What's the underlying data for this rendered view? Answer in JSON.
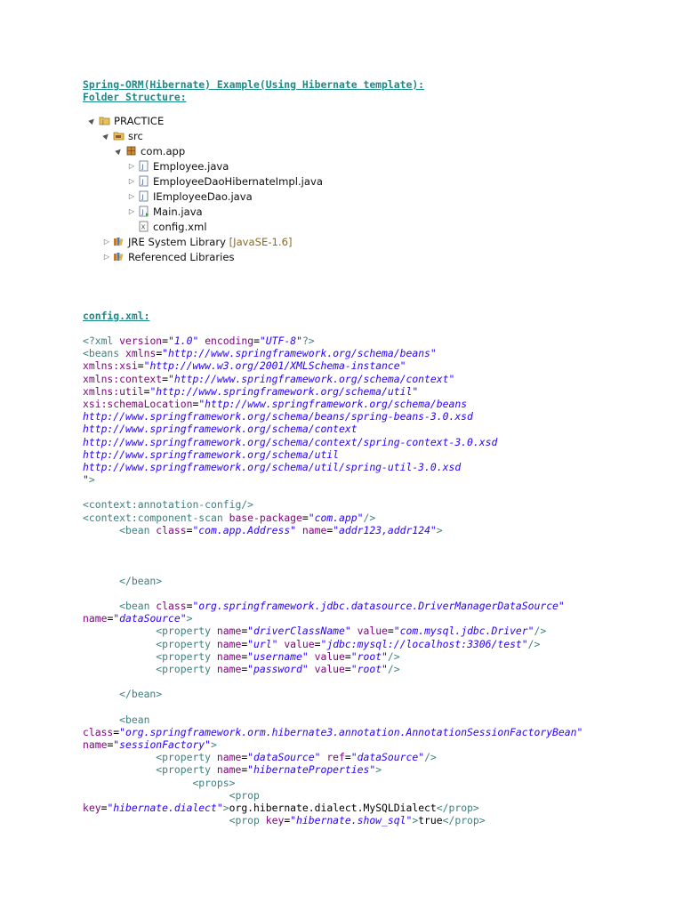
{
  "headings": {
    "title": "Spring-ORM(Hibernate) Example(Using Hibernate template):",
    "folder": "Folder Structure:",
    "config": "config.xml:"
  },
  "tree": [
    {
      "expander": "▲",
      "icon": "project-icon",
      "label": "PRACTICE"
    },
    {
      "expander": "▲",
      "icon": "source-folder-icon",
      "label": "src"
    },
    {
      "expander": "▲",
      "icon": "package-icon",
      "label": "com.app"
    },
    {
      "expander": "▷",
      "icon": "java-file-icon",
      "label": "Employee.java"
    },
    {
      "expander": "▷",
      "icon": "java-file-icon",
      "label": "EmployeeDaoHibernateImpl.java"
    },
    {
      "expander": "▷",
      "icon": "java-file-icon",
      "label": "IEmployeeDao.java"
    },
    {
      "expander": "▷",
      "icon": "java-main-file-icon",
      "label": "Main.java"
    },
    {
      "expander": "",
      "icon": "xml-file-icon",
      "label": "config.xml"
    },
    {
      "expander": "▷",
      "icon": "library-icon",
      "label": "JRE System Library",
      "suffix": " [JavaSE-1.6]"
    },
    {
      "expander": "▷",
      "icon": "library-icon",
      "label": "Referenced Libraries"
    }
  ],
  "code_lines": [
    [
      [
        "t",
        "<?xml "
      ],
      [
        "a",
        "version"
      ],
      [
        "x",
        "="
      ],
      [
        "v",
        "\"1.0\""
      ],
      [
        "t",
        " "
      ],
      [
        "a",
        "encoding"
      ],
      [
        "x",
        "="
      ],
      [
        "v",
        "\"UTF-8\""
      ],
      [
        "t",
        "?>"
      ]
    ],
    [
      [
        "t",
        "<beans "
      ],
      [
        "a",
        "xmlns"
      ],
      [
        "x",
        "="
      ],
      [
        "v",
        "\"http://www.springframework.org/schema/beans\""
      ]
    ],
    [
      [
        "a",
        "xmlns:xsi"
      ],
      [
        "x",
        "="
      ],
      [
        "v",
        "\"http://www.w3.org/2001/XMLSchema-instance\""
      ]
    ],
    [
      [
        "a",
        "xmlns:context"
      ],
      [
        "x",
        "="
      ],
      [
        "v",
        "\"http://www.springframework.org/schema/context\""
      ]
    ],
    [
      [
        "a",
        "xmlns:util"
      ],
      [
        "x",
        "="
      ],
      [
        "v",
        "\"http://www.springframework.org/schema/util\""
      ]
    ],
    [
      [
        "a",
        "xsi:schemaLocation"
      ],
      [
        "x",
        "="
      ],
      [
        "v",
        "\"http://www.springframework.org/schema/beans"
      ]
    ],
    [
      [
        "v",
        "http://www.springframework.org/schema/beans/spring-beans-3.0.xsd"
      ]
    ],
    [
      [
        "v",
        "http://www.springframework.org/schema/context"
      ]
    ],
    [
      [
        "v",
        "http://www.springframework.org/schema/context/spring-context-3.0.xsd"
      ]
    ],
    [
      [
        "v",
        "http://www.springframework.org/schema/util"
      ]
    ],
    [
      [
        "v",
        "http://www.springframework.org/schema/util/spring-util-3.0.xsd"
      ]
    ],
    [
      [
        "v",
        "\""
      ],
      [
        "t",
        ">"
      ]
    ],
    [],
    [
      [
        "t",
        "<context:annotation-config/>"
      ]
    ],
    [
      [
        "t",
        "<context:component-scan "
      ],
      [
        "a",
        "base-package"
      ],
      [
        "x",
        "="
      ],
      [
        "v",
        "\"com.app\""
      ],
      [
        "t",
        "/>"
      ]
    ],
    [
      [
        "t",
        "      <bean "
      ],
      [
        "a",
        "class"
      ],
      [
        "x",
        "="
      ],
      [
        "v",
        "\"com.app.Address\""
      ],
      [
        "t",
        " "
      ],
      [
        "a",
        "name"
      ],
      [
        "x",
        "="
      ],
      [
        "v",
        "\"addr123,addr124\""
      ],
      [
        "t",
        ">"
      ]
    ],
    [],
    [],
    [],
    [
      [
        "t",
        "      </bean>"
      ]
    ],
    [],
    [
      [
        "t",
        "      <bean "
      ],
      [
        "a",
        "class"
      ],
      [
        "x",
        "="
      ],
      [
        "v",
        "\"org.springframework.jdbc.datasource.DriverManagerDataSource\""
      ]
    ],
    [
      [
        "a",
        "name"
      ],
      [
        "x",
        "="
      ],
      [
        "v",
        "\"dataSource\""
      ],
      [
        "t",
        ">"
      ]
    ],
    [
      [
        "t",
        "            <property "
      ],
      [
        "a",
        "name"
      ],
      [
        "x",
        "="
      ],
      [
        "v",
        "\"driverClassName\""
      ],
      [
        "t",
        " "
      ],
      [
        "a",
        "value"
      ],
      [
        "x",
        "="
      ],
      [
        "v",
        "\"com.mysql.jdbc.Driver\""
      ],
      [
        "t",
        "/>"
      ]
    ],
    [
      [
        "t",
        "            <property "
      ],
      [
        "a",
        "name"
      ],
      [
        "x",
        "="
      ],
      [
        "v",
        "\"url\""
      ],
      [
        "t",
        " "
      ],
      [
        "a",
        "value"
      ],
      [
        "x",
        "="
      ],
      [
        "v",
        "\"jdbc:mysql://localhost:3306/test\""
      ],
      [
        "t",
        "/>"
      ]
    ],
    [
      [
        "t",
        "            <property "
      ],
      [
        "a",
        "name"
      ],
      [
        "x",
        "="
      ],
      [
        "v",
        "\"username\""
      ],
      [
        "t",
        " "
      ],
      [
        "a",
        "value"
      ],
      [
        "x",
        "="
      ],
      [
        "v",
        "\"root\""
      ],
      [
        "t",
        "/>"
      ]
    ],
    [
      [
        "t",
        "            <property "
      ],
      [
        "a",
        "name"
      ],
      [
        "x",
        "="
      ],
      [
        "v",
        "\"password\""
      ],
      [
        "t",
        " "
      ],
      [
        "a",
        "value"
      ],
      [
        "x",
        "="
      ],
      [
        "v",
        "\"root\""
      ],
      [
        "t",
        "/>"
      ]
    ],
    [],
    [
      [
        "t",
        "      </bean>"
      ]
    ],
    [],
    [
      [
        "t",
        "      <bean"
      ]
    ],
    [
      [
        "a",
        "class"
      ],
      [
        "x",
        "="
      ],
      [
        "v",
        "\"org.springframework.orm.hibernate3.annotation.AnnotationSessionFactoryBean\""
      ]
    ],
    [
      [
        "a",
        "name"
      ],
      [
        "x",
        "="
      ],
      [
        "v",
        "\"sessionFactory\""
      ],
      [
        "t",
        ">"
      ]
    ],
    [
      [
        "t",
        "            <property "
      ],
      [
        "a",
        "name"
      ],
      [
        "x",
        "="
      ],
      [
        "v",
        "\"dataSource\""
      ],
      [
        "t",
        " "
      ],
      [
        "a",
        "ref"
      ],
      [
        "x",
        "="
      ],
      [
        "v",
        "\"dataSource\""
      ],
      [
        "t",
        "/>"
      ]
    ],
    [
      [
        "t",
        "            <property "
      ],
      [
        "a",
        "name"
      ],
      [
        "x",
        "="
      ],
      [
        "v",
        "\"hibernateProperties\""
      ],
      [
        "t",
        ">"
      ]
    ],
    [
      [
        "t",
        "                  <props>"
      ]
    ],
    [
      [
        "t",
        "                        <prop"
      ]
    ],
    [
      [
        "a",
        "key"
      ],
      [
        "x",
        "="
      ],
      [
        "v",
        "\"hibernate.dialect\""
      ],
      [
        "t",
        ">"
      ],
      [
        "x",
        "org.hibernate.dialect.MySQLDialect"
      ],
      [
        "t",
        "</prop>"
      ]
    ],
    [
      [
        "t",
        "                        <prop "
      ],
      [
        "a",
        "key"
      ],
      [
        "x",
        "="
      ],
      [
        "v",
        "\"hibernate.show_sql\""
      ],
      [
        "t",
        ">"
      ],
      [
        "x",
        "true"
      ],
      [
        "t",
        "</prop>"
      ]
    ]
  ],
  "colors": {
    "heading": "#1a8a8a",
    "tag": "#3f7f7f",
    "attribute": "#7f007f",
    "value": "#2a00ff",
    "text": "#000000"
  }
}
